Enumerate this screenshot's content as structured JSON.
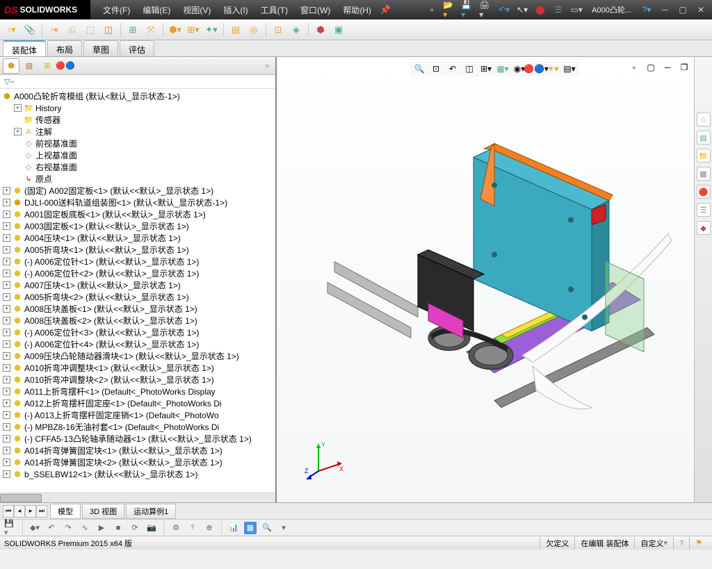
{
  "app": {
    "name": "SOLIDWORKS",
    "doc": "A000凸轮..."
  },
  "menu": [
    "文件(F)",
    "编辑(E)",
    "视图(V)",
    "插入(I)",
    "工具(T)",
    "窗口(W)",
    "帮助(H)"
  ],
  "tabs": [
    "装配体",
    "布局",
    "草图",
    "评估"
  ],
  "tree": {
    "root": "A000凸轮折弯模组  (默认<默认_显示状态-1>)",
    "items": [
      {
        "ico": "folder",
        "exp": "+",
        "txt": "History",
        "indent": 1
      },
      {
        "ico": "folder",
        "txt": "传感器",
        "indent": 1
      },
      {
        "ico": "note",
        "exp": "+",
        "txt": "注解",
        "indent": 1
      },
      {
        "ico": "plane",
        "txt": "前视基准面",
        "indent": 1
      },
      {
        "ico": "plane",
        "txt": "上视基准面",
        "indent": 1
      },
      {
        "ico": "plane",
        "txt": "右视基准面",
        "indent": 1
      },
      {
        "ico": "origin",
        "txt": "原点",
        "indent": 1
      },
      {
        "ico": "part",
        "exp": "+",
        "txt": "(固定) A002固定板<1> (默认<<默认>_显示状态 1>)",
        "indent": 0
      },
      {
        "ico": "asm",
        "exp": "+",
        "txt": "DJLI-000送料轨道组装图<1> (默认<默认_显示状态-1>)",
        "indent": 0
      },
      {
        "ico": "part",
        "exp": "+",
        "txt": "A001固定板底板<1> (默认<<默认>_显示状态 1>)",
        "indent": 0
      },
      {
        "ico": "part",
        "exp": "+",
        "txt": "A003固定板<1> (默认<<默认>_显示状态 1>)",
        "indent": 0
      },
      {
        "ico": "part",
        "exp": "+",
        "txt": "A004压块<1> (默认<<默认>_显示状态 1>)",
        "indent": 0
      },
      {
        "ico": "part",
        "exp": "+",
        "txt": "A005折弯块<1> (默认<<默认>_显示状态 1>)",
        "indent": 0
      },
      {
        "ico": "part",
        "exp": "+",
        "txt": "(-) A006定位针<1> (默认<<默认>_显示状态 1>)",
        "indent": 0
      },
      {
        "ico": "part",
        "exp": "+",
        "txt": "(-) A006定位针<2> (默认<<默认>_显示状态 1>)",
        "indent": 0
      },
      {
        "ico": "part",
        "exp": "+",
        "txt": "A007压块<1> (默认<<默认>_显示状态 1>)",
        "indent": 0
      },
      {
        "ico": "part",
        "exp": "+",
        "txt": "A005折弯块<2> (默认<<默认>_显示状态 1>)",
        "indent": 0
      },
      {
        "ico": "part",
        "exp": "+",
        "txt": "A008压块盖板<1> (默认<<默认>_显示状态 1>)",
        "indent": 0
      },
      {
        "ico": "part",
        "exp": "+",
        "txt": "A008压块盖板<2> (默认<<默认>_显示状态 1>)",
        "indent": 0
      },
      {
        "ico": "part",
        "exp": "+",
        "txt": "(-) A006定位针<3> (默认<<默认>_显示状态 1>)",
        "indent": 0
      },
      {
        "ico": "part",
        "exp": "+",
        "txt": "(-) A006定位针<4> (默认<<默认>_显示状态 1>)",
        "indent": 0
      },
      {
        "ico": "part",
        "exp": "+",
        "txt": "A009压块凸轮随动器滑块<1> (默认<<默认>_显示状态 1>)",
        "indent": 0
      },
      {
        "ico": "part",
        "exp": "+",
        "txt": "A010折弯冲调整块<1> (默认<<默认>_显示状态 1>)",
        "indent": 0
      },
      {
        "ico": "part",
        "exp": "+",
        "txt": "A010折弯冲调整块<2> (默认<<默认>_显示状态 1>)",
        "indent": 0
      },
      {
        "ico": "part",
        "exp": "+",
        "txt": "A011上折弯摆杆<1> (Default<<Default>_PhotoWorks Display",
        "indent": 0
      },
      {
        "ico": "part",
        "exp": "+",
        "txt": "A012上折弯摆杆固定座<1> (Default<<Default>_PhotoWorks Di",
        "indent": 0
      },
      {
        "ico": "part",
        "exp": "+",
        "txt": "(-) A013上折弯摆杆固定座销<1> (Default<<Default>_PhotoWo",
        "indent": 0
      },
      {
        "ico": "part",
        "exp": "+",
        "txt": "(-) MPBZ8-16无油衬套<1> (Default<<Default>_PhotoWorks Di",
        "indent": 0
      },
      {
        "ico": "part",
        "exp": "+",
        "txt": "(-) CFFA5-13凸轮轴承随动器<1> (默认<<默认>_显示状态 1>)",
        "indent": 0
      },
      {
        "ico": "part",
        "exp": "+",
        "txt": "A014折弯弹簧固定块<1> (默认<<默认>_显示状态 1>)",
        "indent": 0
      },
      {
        "ico": "part",
        "exp": "+",
        "txt": "A014折弯弹簧固定块<2> (默认<<默认>_显示状态 1>)",
        "indent": 0
      },
      {
        "ico": "part",
        "exp": "+",
        "txt": "b_SSELBW12<1> (默认<<默认>_显示状态 1>)",
        "indent": 0
      }
    ]
  },
  "bottomTabs": [
    "模型",
    "3D 视图",
    "运动算例1"
  ],
  "status": {
    "left": "SOLIDWORKS Premium 2015 x64 版",
    "segs": [
      "欠定义",
      "在编辑 装配体",
      "自定义"
    ]
  }
}
